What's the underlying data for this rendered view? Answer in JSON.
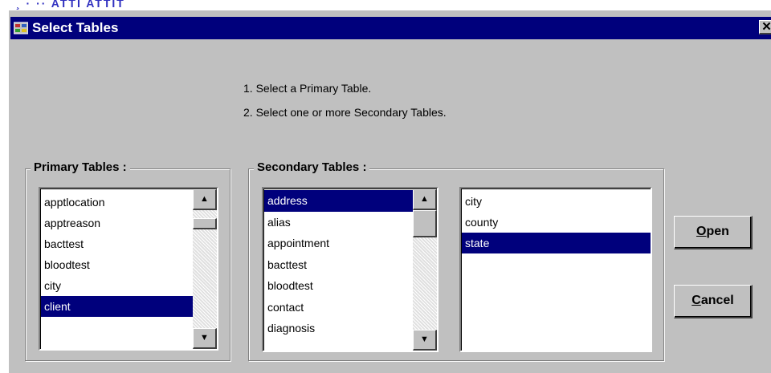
{
  "background_fragment": "¸ · ·· ATTI ATTIT",
  "window": {
    "title": "Select Tables",
    "icon": "app-table-icon",
    "close_glyph": "✕",
    "title_bar_color": "#00007c"
  },
  "instructions": [
    "1. Select a Primary Table.",
    "2. Select one or more Secondary Tables."
  ],
  "primary": {
    "label": "Primary Tables :",
    "items": [
      "apptlocation",
      "apptreason",
      "bacttest",
      "bloodtest",
      "city",
      "client"
    ],
    "selected": "client"
  },
  "secondary": {
    "label": "Secondary Tables :",
    "items": [
      "address",
      "alias",
      "appointment",
      "bacttest",
      "bloodtest",
      "contact",
      "diagnosis"
    ],
    "selected": "address"
  },
  "chosen": {
    "items": [
      "city",
      "county",
      "state"
    ],
    "selected": "state"
  },
  "buttons": {
    "open": {
      "mnemonic": "O",
      "rest": "pen"
    },
    "cancel": {
      "mnemonic": "C",
      "rest": "ancel"
    }
  },
  "scroll_glyphs": {
    "up": "▲",
    "down": "▼"
  },
  "selection_color": "#00007c"
}
